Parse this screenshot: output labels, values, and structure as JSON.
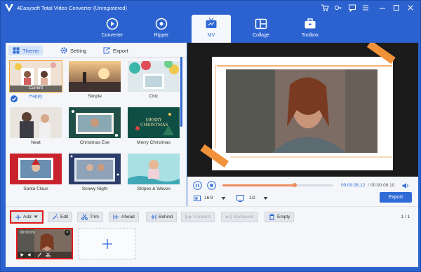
{
  "app": {
    "title": "4Easysoft Total Video Converter (Unregistered)"
  },
  "nav": [
    {
      "label": "Converter"
    },
    {
      "label": "Ripper"
    },
    {
      "label": "MV"
    },
    {
      "label": "Collage"
    },
    {
      "label": "Toolbox"
    }
  ],
  "subtabs": [
    {
      "label": "Theme"
    },
    {
      "label": "Setting"
    },
    {
      "label": "Export"
    }
  ],
  "themes": [
    {
      "label": "Happy",
      "badge": "Current"
    },
    {
      "label": "Simple"
    },
    {
      "label": "Chic"
    },
    {
      "label": "Neat"
    },
    {
      "label": "Christmas Eve"
    },
    {
      "label": "Merry Christmas",
      "overlay": "MERRY CHRISTMAS"
    },
    {
      "label": "Santa Claus"
    },
    {
      "label": "Snowy Night"
    },
    {
      "label": "Stripes & Waves"
    }
  ],
  "player": {
    "current_time": "00:00:06.12",
    "total_time": "00:00:09.10",
    "progress": 0.65,
    "aspect": "16:9",
    "page": "1/2",
    "export_label": "Export"
  },
  "toolbar": {
    "add": "Add",
    "edit": "Edit",
    "trim": "Trim",
    "ahead": "Ahead",
    "behind": "Behind",
    "forward": "Forward",
    "backward": "Backward",
    "empty": "Empty",
    "pager": "1 / 1"
  },
  "clip": {
    "duration": "00:00:09"
  },
  "colors": {
    "brand": "#2b62cf",
    "accent": "#2f6ad6",
    "highlight": "#e11b1b",
    "frame_orange": "#f0923a"
  }
}
